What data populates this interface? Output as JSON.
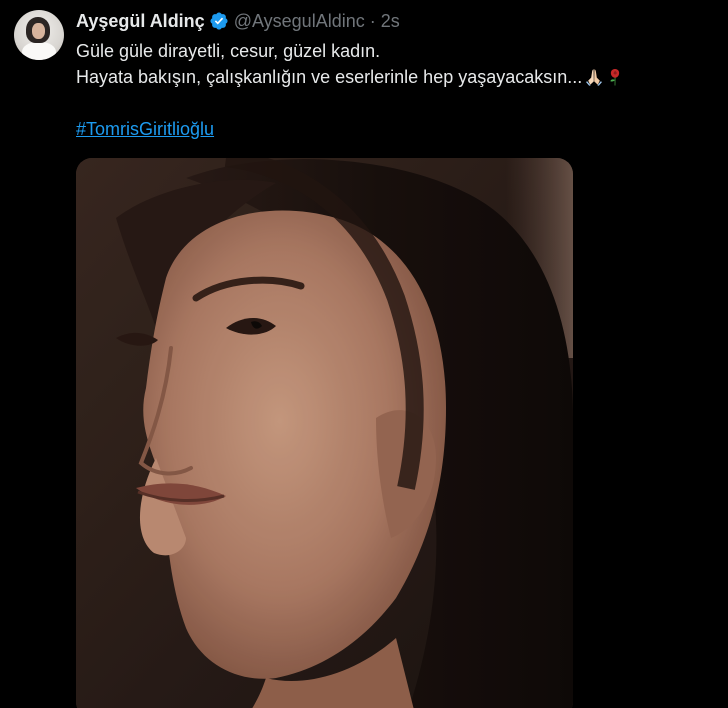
{
  "tweet": {
    "author": {
      "display_name": "Ayşegül Aldinç",
      "handle": "@AysegulAldinc",
      "verified": true,
      "verified_icon": "verified-badge-icon",
      "avatar_icon": "avatar-photo"
    },
    "separator": "·",
    "time": "2s",
    "text_lines": [
      "Güle güle dirayetli, cesur, güzel kadın.",
      "Hayata bakışın, çalışkanlığın ve eserlerinle hep yaşayacaksın..."
    ],
    "emojis": [
      "folded-hands-icon",
      "rose-icon"
    ],
    "hashtag": "#TomrisGiritlioğlu",
    "media": {
      "type": "photo",
      "description_icon": "portrait-photo"
    }
  },
  "colors": {
    "background": "#000000",
    "text": "#e7e9ea",
    "muted": "#71767b",
    "link": "#1d9bf0"
  }
}
